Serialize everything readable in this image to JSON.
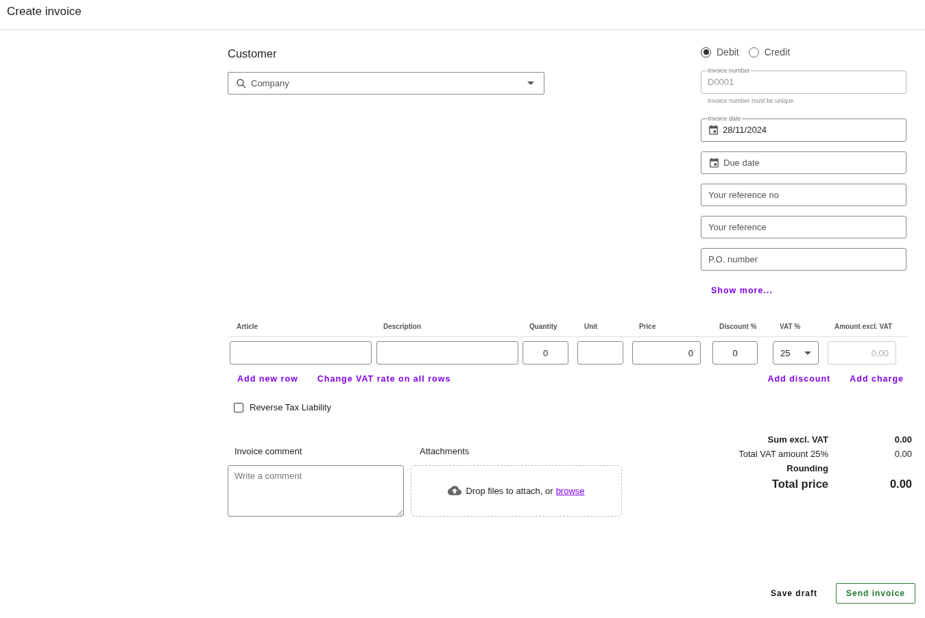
{
  "header": {
    "title": "Create invoice"
  },
  "customer": {
    "heading": "Customer",
    "search": {
      "placeholder": "Company"
    }
  },
  "invoice_type": [
    {
      "label": "Debit",
      "selected": true
    },
    {
      "label": "Credit",
      "selected": false
    }
  ],
  "fields": [
    {
      "kind": "floating",
      "label": "Invoice number",
      "value": "D0001",
      "helper": "Invoice number must be unique",
      "disabled": true
    },
    {
      "kind": "floating-date",
      "label": "Invoice date",
      "value": "28/11/2024",
      "disabled": false
    },
    {
      "kind": "date",
      "placeholder": "Due date"
    },
    {
      "kind": "text",
      "placeholder": "Your reference no"
    },
    {
      "kind": "text",
      "placeholder": "Your reference"
    },
    {
      "kind": "text",
      "placeholder": "P.O. number"
    }
  ],
  "show_more": "Show more...",
  "table": {
    "columns": [
      "Article",
      "Description",
      "Quantity",
      "Unit",
      "Price",
      "Discount %",
      "VAT %",
      "Amount excl. VAT"
    ],
    "row": [
      {
        "kind": "text"
      },
      {
        "kind": "text"
      },
      {
        "kind": "center",
        "value": "0"
      },
      {
        "kind": "text"
      },
      {
        "kind": "right",
        "value": "0"
      },
      {
        "kind": "center",
        "value": "0"
      },
      {
        "kind": "select",
        "value": "25"
      },
      {
        "kind": "readonly",
        "placeholder": "0,00"
      }
    ]
  },
  "row_actions": [
    "Add new row",
    "Change VAT rate on all rows"
  ],
  "price_actions": [
    "Add discount",
    "Add charge"
  ],
  "reverse_tax": {
    "label": "Reverse Tax Liability",
    "checked": false
  },
  "comment": {
    "label": "Invoice comment",
    "placeholder": "Write a comment"
  },
  "attachments": {
    "label": "Attachments",
    "text": "Drop files to attach, or",
    "link": "browse"
  },
  "totals": [
    {
      "kind": "bold",
      "label": "Sum excl. VAT",
      "value": "0.00"
    },
    {
      "kind": "normal",
      "label": "Total VAT amount 25%",
      "value": "0.00"
    },
    {
      "kind": "bold",
      "label": "Rounding"
    },
    {
      "kind": "total",
      "label": "Total price",
      "value": "0.00"
    }
  ],
  "footer": [
    {
      "kind": "text",
      "label": "Save draft"
    },
    {
      "kind": "outlined",
      "label": "Send invoice"
    }
  ]
}
